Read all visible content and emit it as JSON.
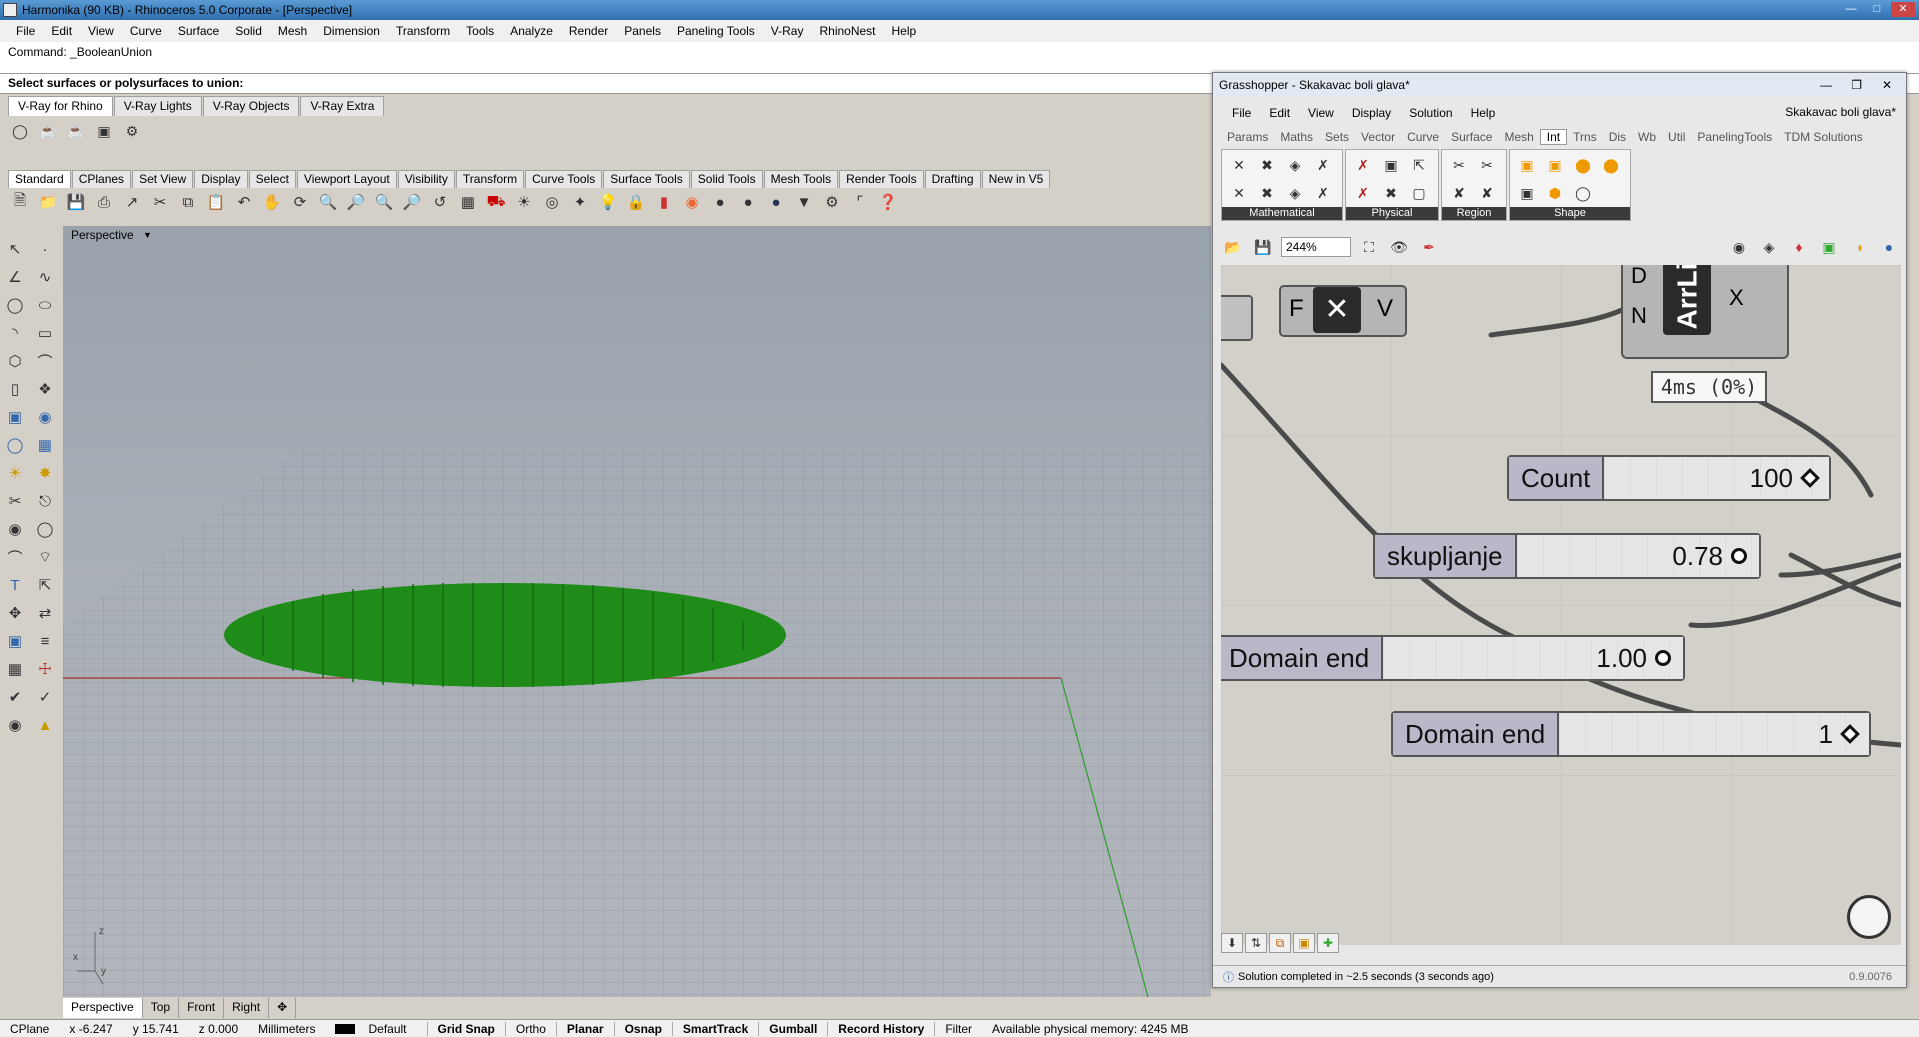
{
  "window": {
    "title": "Harmonika (90 KB) - Rhinoceros  5.0 Corporate - [Perspective]"
  },
  "menu": [
    "File",
    "Edit",
    "View",
    "Curve",
    "Surface",
    "Solid",
    "Mesh",
    "Dimension",
    "Transform",
    "Tools",
    "Analyze",
    "Render",
    "Panels",
    "Paneling Tools",
    "V-Ray",
    "RhinoNest",
    "Help"
  ],
  "command": {
    "history": "Command: _BooleanUnion",
    "prompt": "Select surfaces or polysurfaces to union:"
  },
  "vray_tabs": [
    "V-Ray for Rhino",
    "V-Ray Lights",
    "V-Ray Objects",
    "V-Ray Extra"
  ],
  "std_tabs": [
    "Standard",
    "CPlanes",
    "Set View",
    "Display",
    "Select",
    "Viewport Layout",
    "Visibility",
    "Transform",
    "Curve Tools",
    "Surface Tools",
    "Solid Tools",
    "Mesh Tools",
    "Render Tools",
    "Drafting",
    "New in V5"
  ],
  "viewport": {
    "label": "Perspective",
    "axis_z": "z",
    "axis_x": "x",
    "axis_y": "y"
  },
  "viewport_tabs": [
    "Perspective",
    "Top",
    "Front",
    "Right"
  ],
  "status": {
    "cplane": "CPlane",
    "x": "x -6.247",
    "y": "y 15.741",
    "z": "z 0.000",
    "units": "Millimeters",
    "layer": "Default",
    "toggles": [
      "Grid Snap",
      "Ortho",
      "Planar",
      "Osnap",
      "SmartTrack",
      "Gumball",
      "Record History",
      "Filter"
    ],
    "memory": "Available physical memory: 4245 MB"
  },
  "grasshopper": {
    "title": "Grasshopper - Skakavac boli glava*",
    "doc_name": "Skakavac boli glava*",
    "menu": [
      "File",
      "Edit",
      "View",
      "Display",
      "Solution",
      "Help"
    ],
    "tabs": [
      "Params",
      "Maths",
      "Sets",
      "Vector",
      "Curve",
      "Surface",
      "Mesh",
      "Int",
      "Trns",
      "Dis",
      "Wb",
      "Util",
      "PanelingTools",
      "TDM Solutions"
    ],
    "active_tab": "Int",
    "ribbon_groups": [
      "Mathematical",
      "Physical",
      "Region",
      "Shape"
    ],
    "zoom": "244%",
    "canvas": {
      "node_inputs": [
        "F",
        "V"
      ],
      "arrlist": {
        "inputs": [
          "D",
          "N"
        ],
        "label": "ArrLi",
        "output": "X"
      },
      "timer": "4ms  (0%)",
      "sliders": [
        {
          "name": "Count",
          "value": "100"
        },
        {
          "name": "skupljanje",
          "value": "0.78"
        },
        {
          "name": "Domain end",
          "value": "1.00"
        },
        {
          "name": "Domain end",
          "value": "1"
        }
      ]
    },
    "status": "Solution completed in ~2.5 seconds (3 seconds ago)",
    "version": "0.9.0076"
  }
}
